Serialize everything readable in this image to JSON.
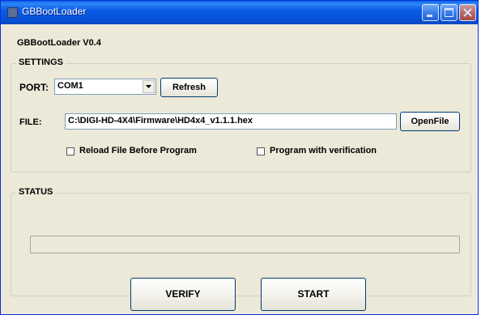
{
  "window": {
    "title": "GBBootLoader"
  },
  "header": {
    "version": "GBBootLoader V0.4"
  },
  "settings": {
    "legend": "SETTINGS",
    "port_label": "PORT:",
    "port_value": "COM1",
    "refresh_label": "Refresh",
    "file_label": "FILE:",
    "file_value": "C:\\DIGI-HD-4X4\\Firmware\\HD4x4_v1.1.1.hex",
    "openfile_label": "OpenFile",
    "reload_label": "Reload File Before Program",
    "reload_checked": false,
    "verify_label": "Program with verification",
    "verify_checked": false
  },
  "status": {
    "legend": "STATUS",
    "progress": 0
  },
  "actions": {
    "verify_label": "VERIFY",
    "start_label": "START"
  },
  "colors": {
    "titlebar": "#0a5ce6",
    "window_bg": "#ece9d8",
    "button_border": "#003c74"
  }
}
